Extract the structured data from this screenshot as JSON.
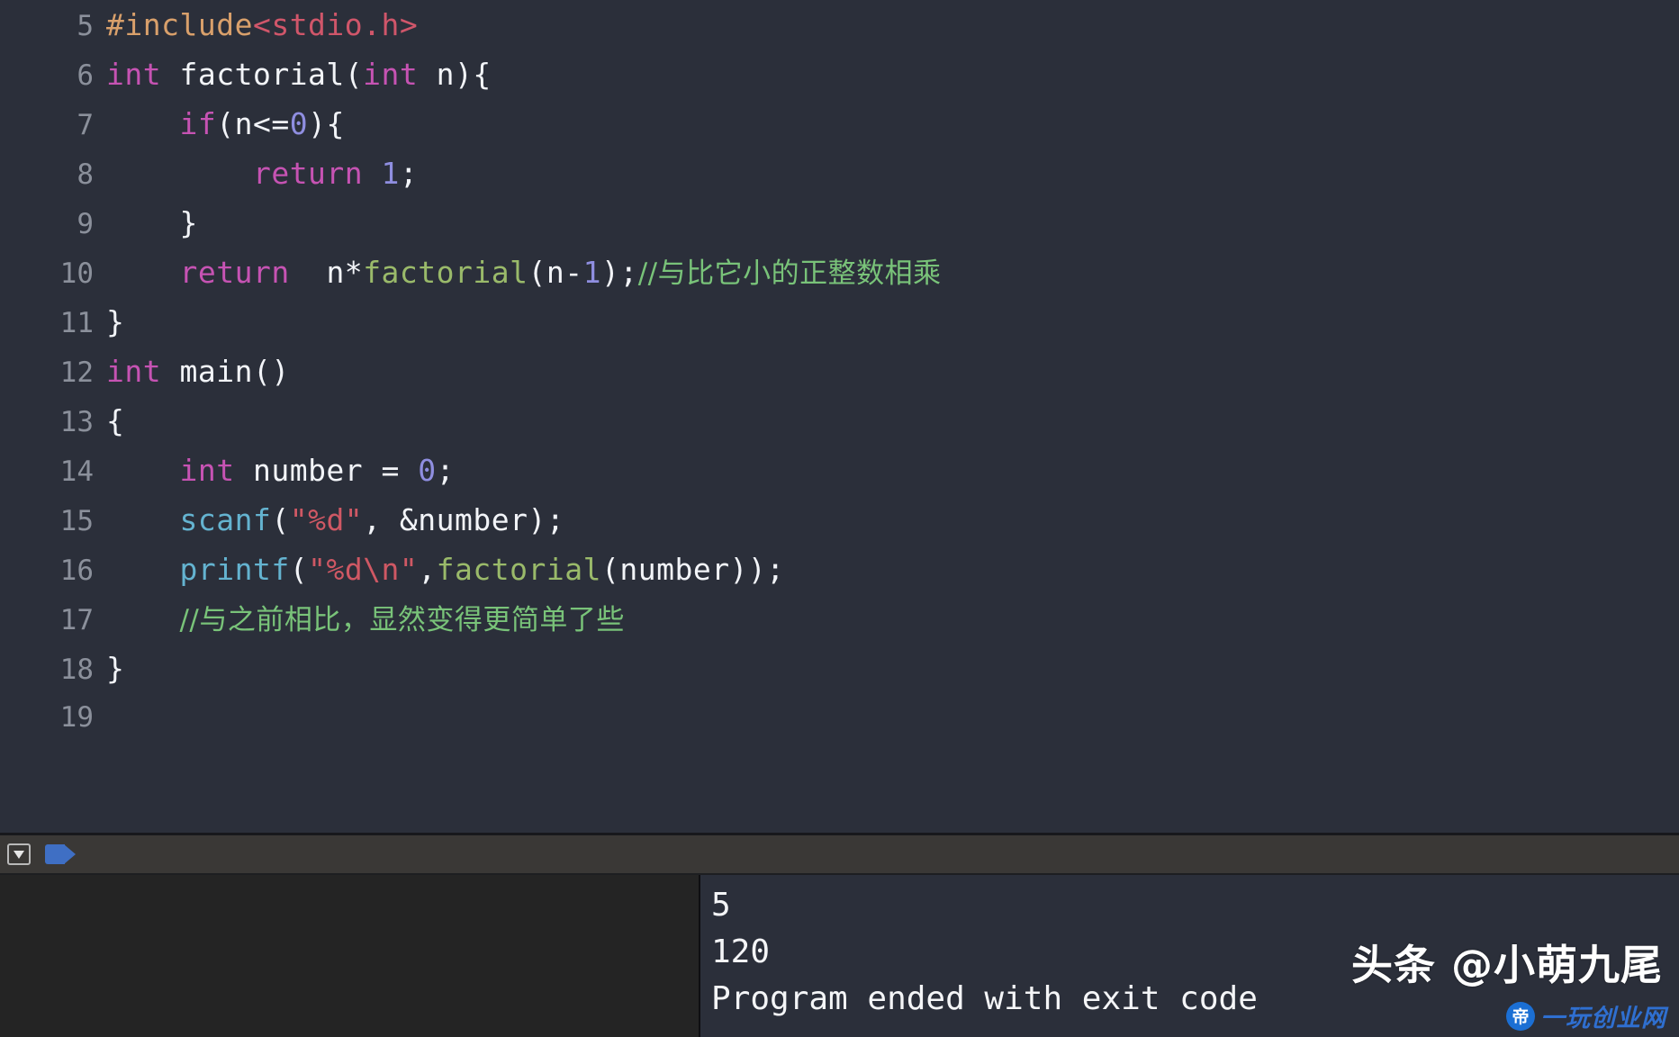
{
  "editor": {
    "first_line_number": 5,
    "lines": [
      {
        "num": "5",
        "tokens": [
          {
            "t": "#include",
            "c": "t-pre"
          },
          {
            "t": "<stdio.h>",
            "c": "t-header"
          }
        ]
      },
      {
        "num": "6",
        "tokens": [
          {
            "t": "int",
            "c": "t-kw"
          },
          {
            "t": " factorial(",
            "c": "t-plain"
          },
          {
            "t": "int",
            "c": "t-kw"
          },
          {
            "t": " n){",
            "c": "t-plain"
          }
        ]
      },
      {
        "num": "7",
        "tokens": [
          {
            "t": "    ",
            "c": "t-plain"
          },
          {
            "t": "if",
            "c": "t-kw"
          },
          {
            "t": "(n<=",
            "c": "t-plain"
          },
          {
            "t": "0",
            "c": "t-num"
          },
          {
            "t": "){",
            "c": "t-plain"
          }
        ]
      },
      {
        "num": "8",
        "tokens": [
          {
            "t": "        ",
            "c": "t-plain"
          },
          {
            "t": "return",
            "c": "t-kw"
          },
          {
            "t": " ",
            "c": "t-plain"
          },
          {
            "t": "1",
            "c": "t-num"
          },
          {
            "t": ";",
            "c": "t-plain"
          }
        ]
      },
      {
        "num": "9",
        "tokens": [
          {
            "t": "    }",
            "c": "t-plain"
          }
        ]
      },
      {
        "num": "10",
        "tokens": [
          {
            "t": "    ",
            "c": "t-plain"
          },
          {
            "t": "return",
            "c": "t-kw"
          },
          {
            "t": "  n*",
            "c": "t-plain"
          },
          {
            "t": "factorial",
            "c": "t-func"
          },
          {
            "t": "(n-",
            "c": "t-plain"
          },
          {
            "t": "1",
            "c": "t-num"
          },
          {
            "t": ");",
            "c": "t-plain"
          },
          {
            "t": "//与比它小的正整数相乘",
            "c": "t-comment cjk"
          }
        ]
      },
      {
        "num": "11",
        "tokens": [
          {
            "t": "}",
            "c": "t-plain"
          }
        ]
      },
      {
        "num": "12",
        "tokens": [
          {
            "t": "int",
            "c": "t-kw"
          },
          {
            "t": " main()",
            "c": "t-plain"
          }
        ]
      },
      {
        "num": "13",
        "tokens": [
          {
            "t": "{",
            "c": "t-plain"
          }
        ]
      },
      {
        "num": "14",
        "tokens": [
          {
            "t": "    ",
            "c": "t-plain"
          },
          {
            "t": "int",
            "c": "t-kw"
          },
          {
            "t": " number = ",
            "c": "t-plain"
          },
          {
            "t": "0",
            "c": "t-num"
          },
          {
            "t": ";",
            "c": "t-plain"
          }
        ]
      },
      {
        "num": "15",
        "tokens": [
          {
            "t": "    ",
            "c": "t-plain"
          },
          {
            "t": "scanf",
            "c": "t-libfunc"
          },
          {
            "t": "(",
            "c": "t-plain"
          },
          {
            "t": "\"%d\"",
            "c": "t-str"
          },
          {
            "t": ", &number);",
            "c": "t-plain"
          }
        ]
      },
      {
        "num": "16",
        "tokens": [
          {
            "t": "    ",
            "c": "t-plain"
          },
          {
            "t": "printf",
            "c": "t-libfunc"
          },
          {
            "t": "(",
            "c": "t-plain"
          },
          {
            "t": "\"%d\\n\"",
            "c": "t-str"
          },
          {
            "t": ",",
            "c": "t-plain"
          },
          {
            "t": "factorial",
            "c": "t-func"
          },
          {
            "t": "(number));",
            "c": "t-plain"
          }
        ]
      },
      {
        "num": "17",
        "tokens": [
          {
            "t": "    ",
            "c": "t-plain"
          },
          {
            "t": "//与之前相比，显然变得更简单了些",
            "c": "t-comment cjk"
          }
        ]
      },
      {
        "num": "18",
        "tokens": [
          {
            "t": "}",
            "c": "t-plain"
          }
        ]
      },
      {
        "num": "19",
        "tokens": []
      }
    ]
  },
  "console": {
    "toolbar": {
      "hide_console_label": "hide-console-icon",
      "filter_label": "filter-tag-icon"
    },
    "variables_pane": {
      "content": ""
    },
    "output_lines": [
      "5",
      "120",
      "Program ended with exit code"
    ]
  },
  "watermark": {
    "main_text": "头条 @小萌九尾",
    "logo_glyph": "帝",
    "sub_text": "一玩创业网"
  },
  "colors": {
    "editor_bg": "#2b2f3a",
    "gutter_text": "#8b909b",
    "toolbar_bg": "#3a3836",
    "variables_pane_bg": "#242424",
    "output_pane_bg": "#2b2f3a",
    "keyword": "#c653b3",
    "preprocessor": "#d9a06b",
    "header_name": "#d0566a",
    "number": "#8f8ee0",
    "user_function": "#9aba6a",
    "library_function": "#64b3d0",
    "string": "#cf5864",
    "comment": "#79c379",
    "plain_text": "#f2f4f8",
    "tag_icon": "#3f6fc4",
    "watermark_logo": "#1b6fd4",
    "watermark_sub": "#2f6fd0"
  }
}
